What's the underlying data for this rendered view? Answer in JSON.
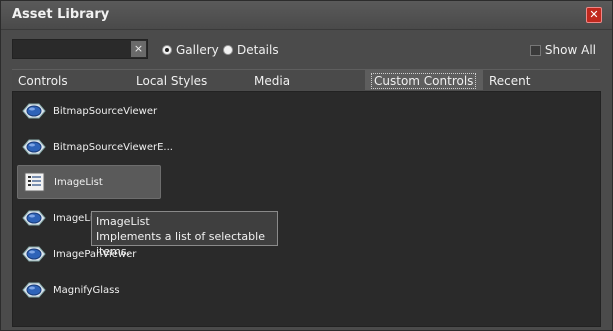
{
  "window": {
    "title": "Asset Library"
  },
  "toolbar": {
    "search": {
      "value": "",
      "placeholder": ""
    },
    "clear_label": "×",
    "view_options": [
      {
        "label": "Gallery",
        "checked": true
      },
      {
        "label": "Details",
        "checked": false
      }
    ],
    "show_all_label": "Show All"
  },
  "tabs": [
    {
      "label": "Controls",
      "selected": false
    },
    {
      "label": "Local Styles",
      "selected": false
    },
    {
      "label": "Media",
      "selected": false
    },
    {
      "label": "Custom Controls",
      "selected": true
    },
    {
      "label": "Recent",
      "selected": false
    }
  ],
  "items": [
    {
      "label": "BitmapSourceViewer",
      "icon": "control-icon",
      "selected": false
    },
    {
      "label": "BitmapSourceViewerE...",
      "icon": "control-icon",
      "selected": false
    },
    {
      "label": "ImageList",
      "icon": "list-document-icon",
      "selected": true
    },
    {
      "label": "ImageLis",
      "icon": "control-icon",
      "selected": false
    },
    {
      "label": "ImagePanViewer",
      "icon": "control-icon",
      "selected": false
    },
    {
      "label": "MagnifyGlass",
      "icon": "control-icon",
      "selected": false
    }
  ],
  "tooltip": {
    "title": "ImageList",
    "description": "Implements a list of selectable items."
  },
  "colors": {
    "accent_close": "#c0281d",
    "panel_bg": "#2a2a2a",
    "window_bg": "#4b4b4b"
  }
}
